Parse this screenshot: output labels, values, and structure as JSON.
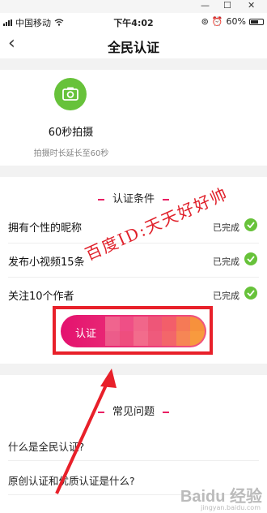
{
  "window": {
    "minimize": "—",
    "maximize": "☐",
    "close": "✕"
  },
  "status_bar": {
    "carrier": "中国移动",
    "time": "下午4:02",
    "battery": "60%"
  },
  "nav": {
    "title": "全民认证"
  },
  "capture": {
    "title": "60秒拍摄",
    "subtitle": "拍摄时长延长至60秒"
  },
  "conditions": {
    "heading": "认证条件",
    "items": [
      {
        "label": "拥有个性的昵称",
        "status": "已完成"
      },
      {
        "label": "发布小视频15条",
        "status": "已完成"
      },
      {
        "label": "关注10个作者",
        "status": "已完成"
      }
    ],
    "button_label": "认证"
  },
  "faq": {
    "heading": "常见问题",
    "items": [
      {
        "q": "什么是全民认证?"
      },
      {
        "q": "原创认证和优质认证是什么?"
      }
    ]
  },
  "overlay": {
    "watermark": "百度ID:天天好好帅",
    "baidu_logo": "Baidu 经验",
    "baidu_sub": "jingyan.baidu.com"
  },
  "colors": {
    "accent": "#e4116f",
    "success": "#67c23a",
    "annotation": "#e8202a"
  }
}
